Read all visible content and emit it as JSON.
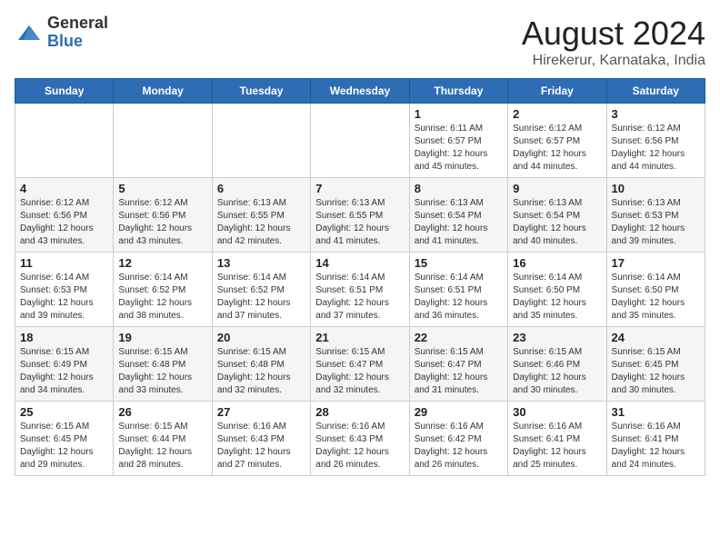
{
  "header": {
    "logo_line1": "General",
    "logo_line2": "Blue",
    "title": "August 2024",
    "subtitle": "Hirekerur, Karnataka, India"
  },
  "weekdays": [
    "Sunday",
    "Monday",
    "Tuesday",
    "Wednesday",
    "Thursday",
    "Friday",
    "Saturday"
  ],
  "weeks": [
    [
      {
        "day": "",
        "detail": ""
      },
      {
        "day": "",
        "detail": ""
      },
      {
        "day": "",
        "detail": ""
      },
      {
        "day": "",
        "detail": ""
      },
      {
        "day": "1",
        "detail": "Sunrise: 6:11 AM\nSunset: 6:57 PM\nDaylight: 12 hours and 45 minutes."
      },
      {
        "day": "2",
        "detail": "Sunrise: 6:12 AM\nSunset: 6:57 PM\nDaylight: 12 hours and 44 minutes."
      },
      {
        "day": "3",
        "detail": "Sunrise: 6:12 AM\nSunset: 6:56 PM\nDaylight: 12 hours and 44 minutes."
      }
    ],
    [
      {
        "day": "4",
        "detail": "Sunrise: 6:12 AM\nSunset: 6:56 PM\nDaylight: 12 hours and 43 minutes."
      },
      {
        "day": "5",
        "detail": "Sunrise: 6:12 AM\nSunset: 6:56 PM\nDaylight: 12 hours and 43 minutes."
      },
      {
        "day": "6",
        "detail": "Sunrise: 6:13 AM\nSunset: 6:55 PM\nDaylight: 12 hours and 42 minutes."
      },
      {
        "day": "7",
        "detail": "Sunrise: 6:13 AM\nSunset: 6:55 PM\nDaylight: 12 hours and 41 minutes."
      },
      {
        "day": "8",
        "detail": "Sunrise: 6:13 AM\nSunset: 6:54 PM\nDaylight: 12 hours and 41 minutes."
      },
      {
        "day": "9",
        "detail": "Sunrise: 6:13 AM\nSunset: 6:54 PM\nDaylight: 12 hours and 40 minutes."
      },
      {
        "day": "10",
        "detail": "Sunrise: 6:13 AM\nSunset: 6:53 PM\nDaylight: 12 hours and 39 minutes."
      }
    ],
    [
      {
        "day": "11",
        "detail": "Sunrise: 6:14 AM\nSunset: 6:53 PM\nDaylight: 12 hours and 39 minutes."
      },
      {
        "day": "12",
        "detail": "Sunrise: 6:14 AM\nSunset: 6:52 PM\nDaylight: 12 hours and 38 minutes."
      },
      {
        "day": "13",
        "detail": "Sunrise: 6:14 AM\nSunset: 6:52 PM\nDaylight: 12 hours and 37 minutes."
      },
      {
        "day": "14",
        "detail": "Sunrise: 6:14 AM\nSunset: 6:51 PM\nDaylight: 12 hours and 37 minutes."
      },
      {
        "day": "15",
        "detail": "Sunrise: 6:14 AM\nSunset: 6:51 PM\nDaylight: 12 hours and 36 minutes."
      },
      {
        "day": "16",
        "detail": "Sunrise: 6:14 AM\nSunset: 6:50 PM\nDaylight: 12 hours and 35 minutes."
      },
      {
        "day": "17",
        "detail": "Sunrise: 6:14 AM\nSunset: 6:50 PM\nDaylight: 12 hours and 35 minutes."
      }
    ],
    [
      {
        "day": "18",
        "detail": "Sunrise: 6:15 AM\nSunset: 6:49 PM\nDaylight: 12 hours and 34 minutes."
      },
      {
        "day": "19",
        "detail": "Sunrise: 6:15 AM\nSunset: 6:48 PM\nDaylight: 12 hours and 33 minutes."
      },
      {
        "day": "20",
        "detail": "Sunrise: 6:15 AM\nSunset: 6:48 PM\nDaylight: 12 hours and 32 minutes."
      },
      {
        "day": "21",
        "detail": "Sunrise: 6:15 AM\nSunset: 6:47 PM\nDaylight: 12 hours and 32 minutes."
      },
      {
        "day": "22",
        "detail": "Sunrise: 6:15 AM\nSunset: 6:47 PM\nDaylight: 12 hours and 31 minutes."
      },
      {
        "day": "23",
        "detail": "Sunrise: 6:15 AM\nSunset: 6:46 PM\nDaylight: 12 hours and 30 minutes."
      },
      {
        "day": "24",
        "detail": "Sunrise: 6:15 AM\nSunset: 6:45 PM\nDaylight: 12 hours and 30 minutes."
      }
    ],
    [
      {
        "day": "25",
        "detail": "Sunrise: 6:15 AM\nSunset: 6:45 PM\nDaylight: 12 hours and 29 minutes."
      },
      {
        "day": "26",
        "detail": "Sunrise: 6:15 AM\nSunset: 6:44 PM\nDaylight: 12 hours and 28 minutes."
      },
      {
        "day": "27",
        "detail": "Sunrise: 6:16 AM\nSunset: 6:43 PM\nDaylight: 12 hours and 27 minutes."
      },
      {
        "day": "28",
        "detail": "Sunrise: 6:16 AM\nSunset: 6:43 PM\nDaylight: 12 hours and 26 minutes."
      },
      {
        "day": "29",
        "detail": "Sunrise: 6:16 AM\nSunset: 6:42 PM\nDaylight: 12 hours and 26 minutes."
      },
      {
        "day": "30",
        "detail": "Sunrise: 6:16 AM\nSunset: 6:41 PM\nDaylight: 12 hours and 25 minutes."
      },
      {
        "day": "31",
        "detail": "Sunrise: 6:16 AM\nSunset: 6:41 PM\nDaylight: 12 hours and 24 minutes."
      }
    ]
  ]
}
